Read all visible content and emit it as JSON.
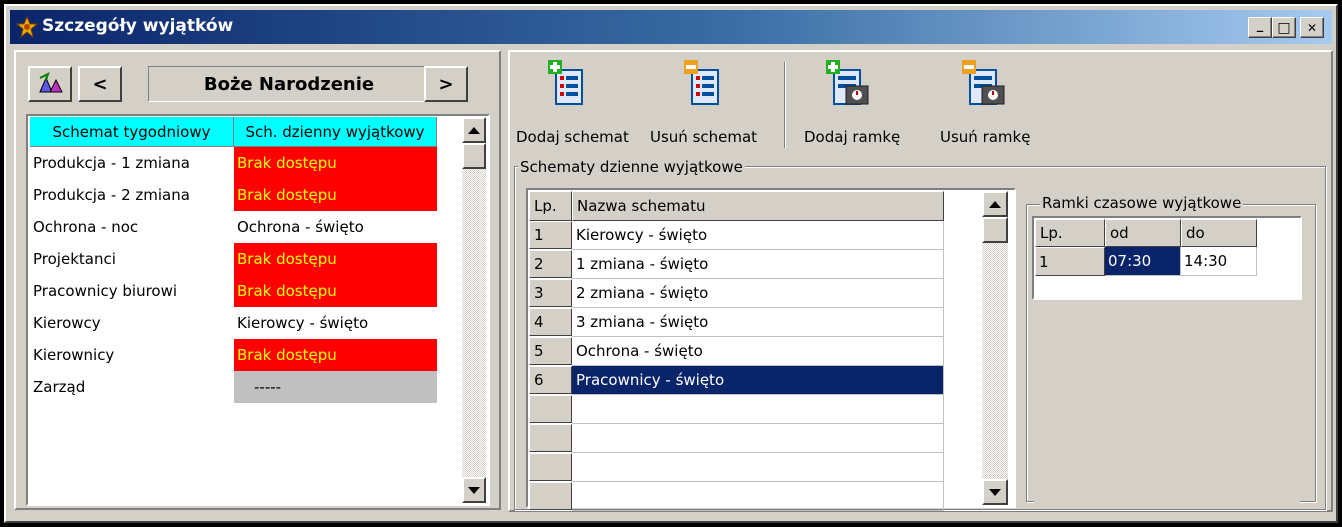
{
  "window": {
    "title": "Szczegóły wyjątków",
    "minimize": "_",
    "maximize": "□",
    "close": "✕"
  },
  "nav": {
    "current": "Boże Narodzenie",
    "prev": "<",
    "next": ">"
  },
  "weekly_grid": {
    "headers": [
      "Schemat tygodniowy",
      "Sch. dzienny wyjątkowy"
    ],
    "rows": [
      {
        "schema": "Produkcja - 1 zmiana",
        "daily": "Brak dostępu",
        "status": "denied"
      },
      {
        "schema": "Produkcja - 2 zmiana",
        "daily": "Brak dostępu",
        "status": "denied"
      },
      {
        "schema": "Ochrona - noc",
        "daily": "Ochrona - święto",
        "status": "normal"
      },
      {
        "schema": "Projektanci",
        "daily": "Brak dostępu",
        "status": "denied"
      },
      {
        "schema": "Pracownicy biurowi",
        "daily": "Brak dostępu",
        "status": "denied"
      },
      {
        "schema": "Kierowcy",
        "daily": "Kierowcy - święto",
        "status": "normal"
      },
      {
        "schema": "Kierownicy",
        "daily": "Brak dostępu",
        "status": "denied"
      },
      {
        "schema": "Zarząd",
        "daily": "-----",
        "status": "none"
      }
    ]
  },
  "toolbar": {
    "add_schema": "Dodaj schemat",
    "remove_schema": "Usuń schemat",
    "add_frame": "Dodaj ramkę",
    "remove_frame": "Usuń ramkę"
  },
  "daily_schemas": {
    "group_title": "Schematy dzienne wyjątkowe",
    "headers": [
      "Lp.",
      "Nazwa schematu"
    ],
    "rows": [
      {
        "lp": "1",
        "name": "Kierowcy - święto"
      },
      {
        "lp": "2",
        "name": "1 zmiana - święto"
      },
      {
        "lp": "3",
        "name": "2 zmiana - święto"
      },
      {
        "lp": "4",
        "name": "3 zmiana - święto"
      },
      {
        "lp": "5",
        "name": "Ochrona - święto"
      },
      {
        "lp": "6",
        "name": "Pracownicy - święto"
      }
    ],
    "selected_index": 5
  },
  "time_frames": {
    "group_title": "Ramki czasowe wyjątkowe",
    "headers": [
      "Lp.",
      "od",
      "do"
    ],
    "rows": [
      {
        "lp": "1",
        "from": "07:30",
        "to": "14:30"
      }
    ]
  },
  "colors": {
    "denied_bg": "#ff0000",
    "denied_text": "#ffff00",
    "header_cyan": "#00ffff",
    "selection": "#0a246a",
    "empty_row": "#c0c0c0"
  }
}
